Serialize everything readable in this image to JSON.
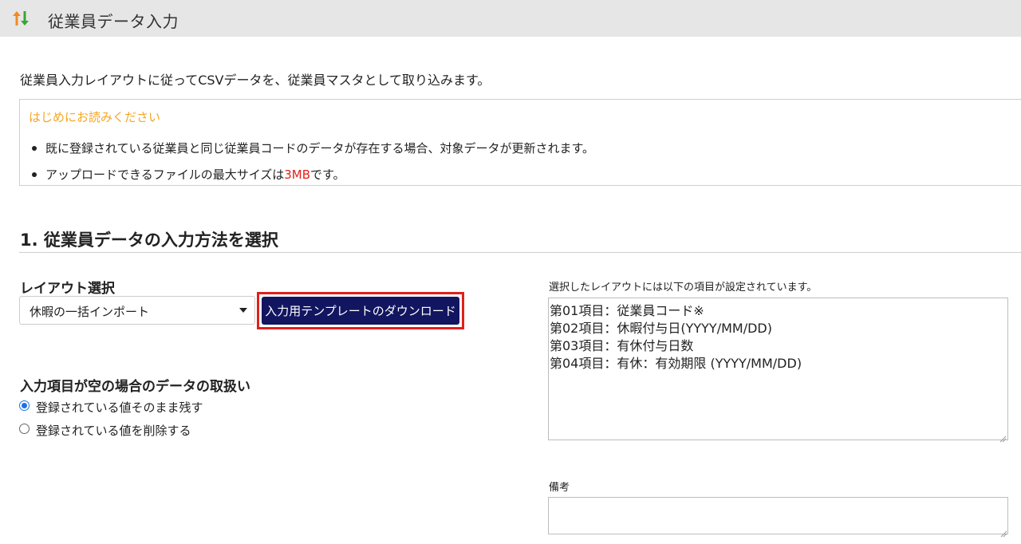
{
  "header": {
    "title": "従業員データ入力",
    "icon": "sort-arrows-icon"
  },
  "intro_text": "従業員入力レイアウトに従ってCSVデータを、従業員マスタとして取り込みます。",
  "notice": {
    "title": "はじめにお読みください",
    "items": [
      "既に登録されている従業員と同じ従業員コードのデータが存在する場合、対象データが更新されます。"
    ],
    "size_prefix": "アップロードできるファイルの最大サイズは",
    "size_value": "3MB",
    "size_suffix": "です。",
    "title_color": "#f5a623",
    "highlight_color": "#e0201b"
  },
  "section": {
    "heading": "1. 従業員データの入力方法を選択"
  },
  "layout_select": {
    "label": "レイアウト選択",
    "value": "休暇の一括インポート"
  },
  "download_button": {
    "label": "入力用テンプレートのダウンロード",
    "color": "#121660",
    "highlight_color": "#e0201b"
  },
  "empty_handling": {
    "label": "入力項目が空の場合のデータの取扱い",
    "options": [
      {
        "label": "登録されている値そのまま残す",
        "selected": true
      },
      {
        "label": "登録されている値を削除する",
        "selected": false
      }
    ]
  },
  "layout_items": {
    "label": "選択したレイアウトには以下の項目が設定されています。",
    "lines": [
      "第01項目：従業員コード※",
      "第02項目：休暇付与日(YYYY/MM/DD)",
      "第03項目：有休付与日数",
      "第04項目：有休：有効期限 (YYYY/MM/DD)"
    ]
  },
  "memo": {
    "label": "備考",
    "value": ""
  }
}
